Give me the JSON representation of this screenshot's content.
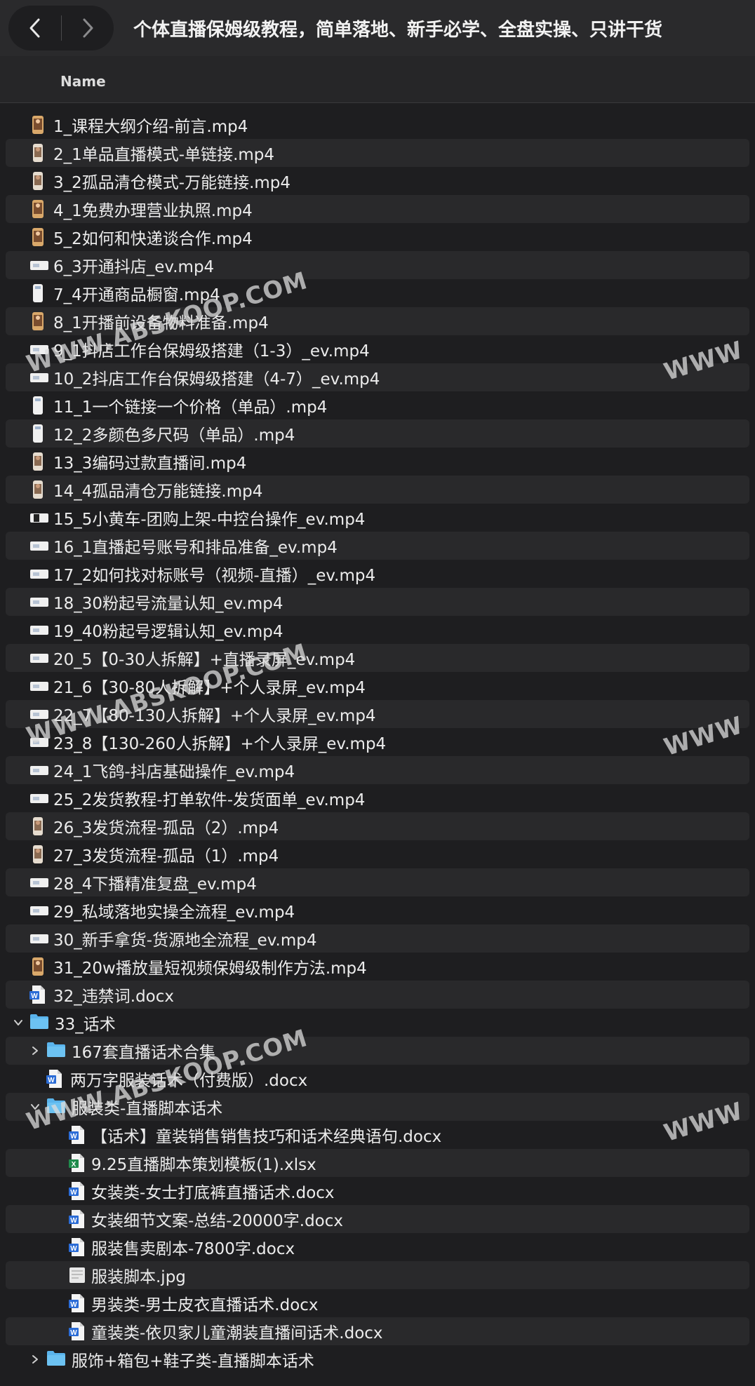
{
  "window": {
    "title": "个体直播保姆级教程，简单落地、新手必学、全盘实操、只讲干货"
  },
  "nav": {
    "back_icon": "chevron-left-icon",
    "forward_icon": "chevron-right-icon"
  },
  "column_header": {
    "name": "Name"
  },
  "files": [
    {
      "name": "1_课程大纲介绍-前言.mp4",
      "type": "video-portrait",
      "level": 0
    },
    {
      "name": "2_1单品直播模式-单链接.mp4",
      "type": "video-tall",
      "level": 0
    },
    {
      "name": "3_2孤品清仓模式-万能链接.mp4",
      "type": "video-tall",
      "level": 0
    },
    {
      "name": "4_1免费办理营业执照.mp4",
      "type": "video-portrait",
      "level": 0
    },
    {
      "name": "5_2如何和快递谈合作.mp4",
      "type": "video-portrait",
      "level": 0
    },
    {
      "name": "6_3开通抖店_ev.mp4",
      "type": "video-wide",
      "level": 0
    },
    {
      "name": "7_4开通商品橱窗.mp4",
      "type": "video-phone",
      "level": 0
    },
    {
      "name": "8_1开播前设备物料准备.mp4",
      "type": "video-portrait",
      "level": 0
    },
    {
      "name": "9_1抖店工作台保姆级搭建（1-3）_ev.mp4",
      "type": "video-wide",
      "level": 0
    },
    {
      "name": "10_2抖店工作台保姆级搭建（4-7）_ev.mp4",
      "type": "video-wide",
      "level": 0
    },
    {
      "name": "11_1一个链接一个价格（单品）.mp4",
      "type": "video-phone",
      "level": 0
    },
    {
      "name": "12_2多颜色多尺码（单品）.mp4",
      "type": "video-phone",
      "level": 0
    },
    {
      "name": "13_3编码过款直播间.mp4",
      "type": "video-tall",
      "level": 0
    },
    {
      "name": "14_4孤品清仓万能链接.mp4",
      "type": "video-tall",
      "level": 0
    },
    {
      "name": "15_5小黄车-团购上架-中控台操作_ev.mp4",
      "type": "video-dark",
      "level": 0
    },
    {
      "name": "16_1直播起号账号和排品准备_ev.mp4",
      "type": "video-wide",
      "level": 0
    },
    {
      "name": "17_2如何找对标账号（视频-直播）_ev.mp4",
      "type": "video-wide",
      "level": 0
    },
    {
      "name": "18_30粉起号流量认知_ev.mp4",
      "type": "video-wide",
      "level": 0
    },
    {
      "name": "19_40粉起号逻辑认知_ev.mp4",
      "type": "video-wide",
      "level": 0
    },
    {
      "name": "20_5【0-30人拆解】+直播录屏_ev.mp4",
      "type": "video-wide",
      "level": 0
    },
    {
      "name": "21_6【30-80人拆解】+个人录屏_ev.mp4",
      "type": "video-wide",
      "level": 0
    },
    {
      "name": "22_7【80-130人拆解】+个人录屏_ev.mp4",
      "type": "video-wide",
      "level": 0
    },
    {
      "name": "23_8【130-260人拆解】+个人录屏_ev.mp4",
      "type": "video-wide",
      "level": 0
    },
    {
      "name": "24_1飞鸽-抖店基础操作_ev.mp4",
      "type": "video-wide",
      "level": 0
    },
    {
      "name": "25_2发货教程-打单软件-发货面单_ev.mp4",
      "type": "video-wide",
      "level": 0
    },
    {
      "name": "26_3发货流程-孤品（2）.mp4",
      "type": "video-tall",
      "level": 0
    },
    {
      "name": "27_3发货流程-孤品（1）.mp4",
      "type": "video-tall",
      "level": 0
    },
    {
      "name": "28_4下播精准复盘_ev.mp4",
      "type": "video-wide",
      "level": 0
    },
    {
      "name": "29_私域落地实操全流程_ev.mp4",
      "type": "video-wide",
      "level": 0
    },
    {
      "name": "30_新手拿货-货源地全流程_ev.mp4",
      "type": "video-wide",
      "level": 0
    },
    {
      "name": "31_20w播放量短视频保姆级制作方法.mp4",
      "type": "video-portrait",
      "level": 0
    },
    {
      "name": "32_违禁词.docx",
      "type": "docx",
      "level": 0
    },
    {
      "name": "33_话术",
      "type": "folder",
      "level": 0,
      "expanded": true
    },
    {
      "name": "167套直播话术合集",
      "type": "folder",
      "level": 1,
      "expanded": false
    },
    {
      "name": "两万字服装话术（付费版）.docx",
      "type": "docx",
      "level": 1
    },
    {
      "name": "服装类-直播脚本话术",
      "type": "folder",
      "level": 1,
      "expanded": true
    },
    {
      "name": "【话术】童装销售销售技巧和话术经典语句.docx",
      "type": "docx",
      "level": 2
    },
    {
      "name": "9.25直播脚本策划模板(1).xlsx",
      "type": "xlsx",
      "level": 2
    },
    {
      "name": "女装类-女士打底裤直播话术.docx",
      "type": "docx",
      "level": 2
    },
    {
      "name": "女装细节文案-总结-20000字.docx",
      "type": "docx",
      "level": 2
    },
    {
      "name": "服装售卖剧本-7800字.docx",
      "type": "docx",
      "level": 2
    },
    {
      "name": "服装脚本.jpg",
      "type": "jpg",
      "level": 2
    },
    {
      "name": "男装类-男士皮衣直播话术.docx",
      "type": "docx",
      "level": 2
    },
    {
      "name": "童装类-依贝家儿童潮装直播间话术.docx",
      "type": "docx",
      "level": 2
    },
    {
      "name": "服饰+箱包+鞋子类-直播脚本话术",
      "type": "folder",
      "level": 1,
      "expanded": false
    }
  ],
  "watermarks": [
    "WWW.ABSKOOP.COM",
    "WWW"
  ],
  "colors": {
    "folder": "#5ab4ec",
    "word": "#2b6cd6",
    "excel": "#1f8a4c",
    "row_alt": "#29292b",
    "bg": "#1e1e20"
  }
}
